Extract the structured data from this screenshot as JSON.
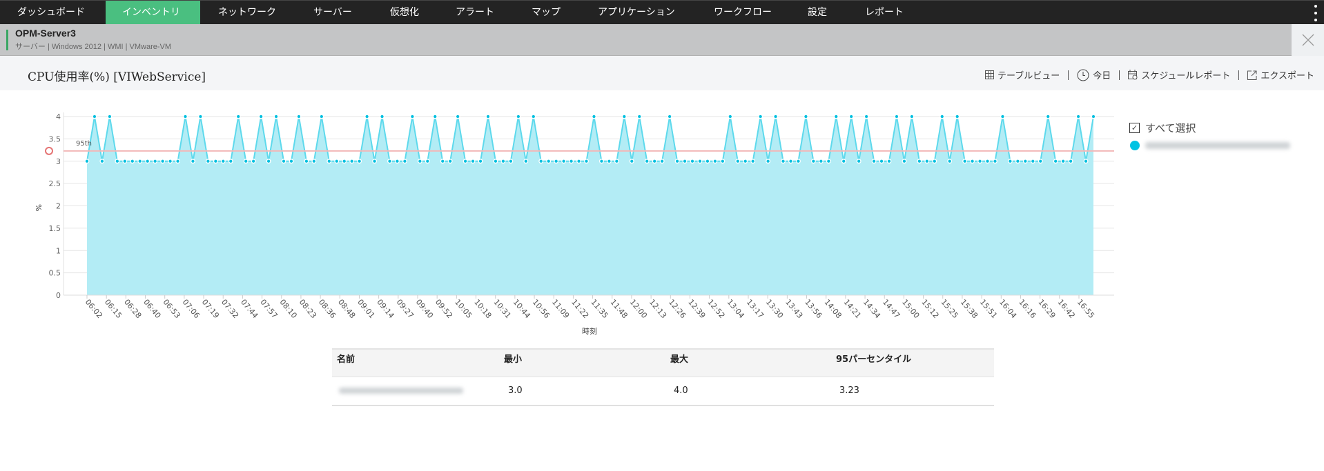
{
  "nav": {
    "items": [
      "ダッシュボード",
      "インベントリ",
      "ネットワーク",
      "サーバー",
      "仮想化",
      "アラート",
      "マップ",
      "アプリケーション",
      "ワークフロー",
      "設定",
      "レポート"
    ],
    "active": "インベントリ",
    "accent": "#4abf80"
  },
  "header": {
    "name": "OPM-Server3",
    "meta": "サーバー | Windows 2012 | WMI | VMware-VM"
  },
  "page": {
    "title": "CPU使用率(%) [VIWebService]",
    "toolbar": {
      "table_view": "テーブルビュー",
      "today": "今日",
      "schedule": "スケジュールレポート",
      "export": "エクスポート"
    }
  },
  "legend": {
    "select_all": "すべて選択"
  },
  "chart_data": {
    "type": "area",
    "xlabel": "時刻",
    "ylabel": "%",
    "ylim": [
      0,
      4
    ],
    "yticks": [
      "0",
      "0.5",
      "1",
      "1.5",
      "2",
      "2.5",
      "3",
      "3.5",
      "4"
    ],
    "xticks": [
      "06:02",
      "06:15",
      "06:28",
      "06:40",
      "06:53",
      "07:06",
      "07:19",
      "07:32",
      "07:44",
      "07:57",
      "08:10",
      "08:23",
      "08:36",
      "08:48",
      "09:01",
      "09:14",
      "09:27",
      "09:40",
      "09:52",
      "10:05",
      "10:18",
      "10:31",
      "10:44",
      "10:56",
      "11:09",
      "11:22",
      "11:35",
      "11:48",
      "12:00",
      "12:13",
      "12:26",
      "12:39",
      "12:52",
      "13:04",
      "13:17",
      "13:30",
      "13:43",
      "13:56",
      "14:08",
      "14:21",
      "14:34",
      "14:47",
      "15:00",
      "15:12",
      "15:25",
      "15:38",
      "15:51",
      "16:04",
      "16:16",
      "16:29",
      "16:42",
      "16:55"
    ],
    "interval_minutes": 5,
    "peak_indices": [
      1,
      3,
      13,
      15,
      20,
      23,
      25,
      28,
      31,
      37,
      39,
      43,
      46,
      49,
      53,
      57,
      59,
      67,
      71,
      73,
      77,
      85,
      89,
      91,
      95,
      99,
      101,
      103,
      107,
      109,
      113,
      115,
      121,
      127,
      131,
      133
    ],
    "point_count": 134,
    "base_value": 3,
    "peak_value": 4,
    "percentile_95": 3.23,
    "percentile_label": "95th",
    "grid": true,
    "colors": {
      "fill": "#b3ecf5",
      "line": "#5dd9ec",
      "point": "#00c0e0",
      "percentile": "#f2b8b8"
    }
  },
  "table": {
    "headers": [
      "名前",
      "最小",
      "最大",
      "95パーセンタイル"
    ],
    "rows": [
      {
        "min": "3.0",
        "max": "4.0",
        "p95": "3.23"
      }
    ]
  }
}
